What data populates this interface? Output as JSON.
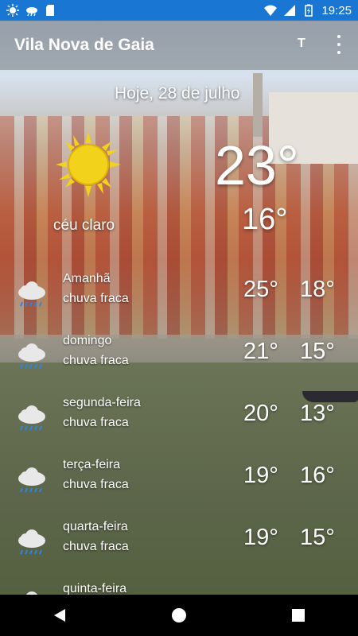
{
  "status": {
    "time": "19:25"
  },
  "app": {
    "title": "Vila Nova de Gaia",
    "text_size_button": "T"
  },
  "today": {
    "date": "Hoje, 28 de julho",
    "temp": "23°",
    "min": "16°",
    "condition": "céu claro",
    "icon": "sun-icon"
  },
  "forecast": [
    {
      "day": "Amanhã",
      "desc": "chuva fraca",
      "hi": "25°",
      "lo": "18°",
      "icon": "rain-cloud-icon"
    },
    {
      "day": "domingo",
      "desc": "chuva fraca",
      "hi": "21°",
      "lo": "15°",
      "icon": "rain-cloud-icon"
    },
    {
      "day": "segunda-feira",
      "desc": "chuva fraca",
      "hi": "20°",
      "lo": "13°",
      "icon": "rain-cloud-icon"
    },
    {
      "day": "terça-feira",
      "desc": "chuva fraca",
      "hi": "19°",
      "lo": "16°",
      "icon": "rain-cloud-icon"
    },
    {
      "day": "quarta-feira",
      "desc": "chuva fraca",
      "hi": "19°",
      "lo": "15°",
      "icon": "rain-cloud-icon"
    },
    {
      "day": "quinta-feira",
      "desc": "",
      "hi": "",
      "lo": "",
      "icon": "rain-cloud-icon"
    }
  ],
  "colors": {
    "statusbar": "#1976d2",
    "sun": "#f2d21b",
    "rain": "#2e86de"
  }
}
